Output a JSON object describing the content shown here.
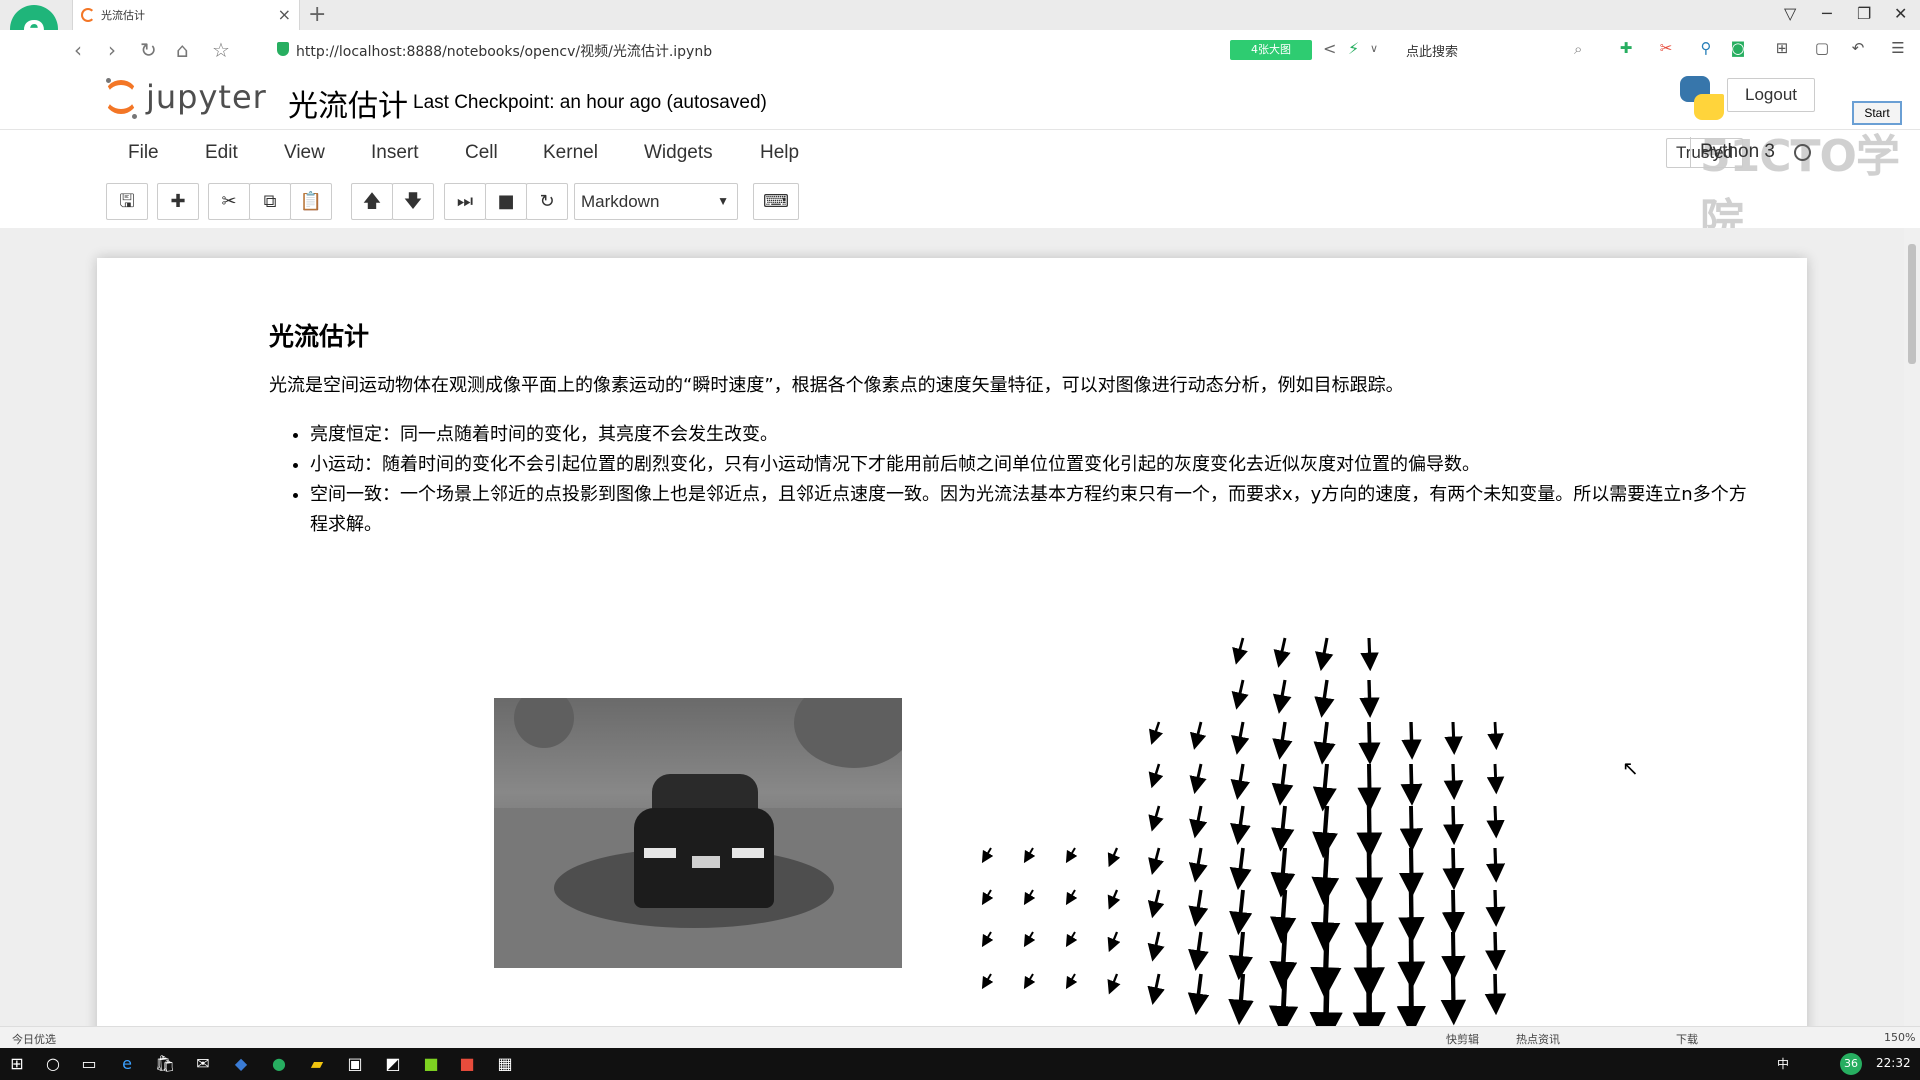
{
  "browser": {
    "tab_title": "光流估计",
    "tab_close": "×",
    "new_tab": "+",
    "url": "http://localhost:8888/notebooks/opencv/视频/光流估计.ipynb",
    "big_pic_button": "4张大图",
    "search_placeholder": "点此搜索"
  },
  "jupyter": {
    "logo_text": "jupyter",
    "notebook_name": "光流估计",
    "checkpoint": "Last Checkpoint: an hour ago (autosaved)",
    "logout": "Logout",
    "start": "Start",
    "watermark": "51CTO学院"
  },
  "menubar": {
    "items": [
      "File",
      "Edit",
      "View",
      "Insert",
      "Cell",
      "Kernel",
      "Widgets",
      "Help"
    ],
    "trusted": "Trusted",
    "kernel": "Python 3"
  },
  "toolbar": {
    "cell_type": "Markdown",
    "icons": [
      "save-icon",
      "plus-icon",
      "cut-icon",
      "copy-icon",
      "paste-icon",
      "arrow-up-icon",
      "arrow-down-icon",
      "run-icon",
      "stop-icon",
      "restart-icon",
      "keyboard-icon"
    ]
  },
  "markdown": {
    "title": "光流估计",
    "intro": "光流是空间运动物体在观测成像平面上的像素运动的“瞬时速度”，根据各个像素点的速度矢量特征，可以对图像进行动态分析，例如目标跟踪。",
    "bullets": [
      "亮度恒定：同一点随着时间的变化，其亮度不会发生改变。",
      "小运动：随着时间的变化不会引起位置的剧烈变化，只有小运动情况下才能用前后帧之间单位位置变化引起的灰度变化去近似灰度对位置的偏导数。",
      "空间一致：一个场景上邻近的点投影到图像上也是邻近点，且邻近点速度一致。因为光流法基本方程约束只有一个，而要求x，y方向的速度，有两个未知变量。所以需要连立n多个方程求解。"
    ]
  },
  "statusbar": {
    "left": "今日优选",
    "items": [
      "快剪辑",
      "热点资讯",
      "下载",
      "150%"
    ]
  },
  "taskbar": {
    "clock": "22:32",
    "ime": "中",
    "temp": "36"
  }
}
